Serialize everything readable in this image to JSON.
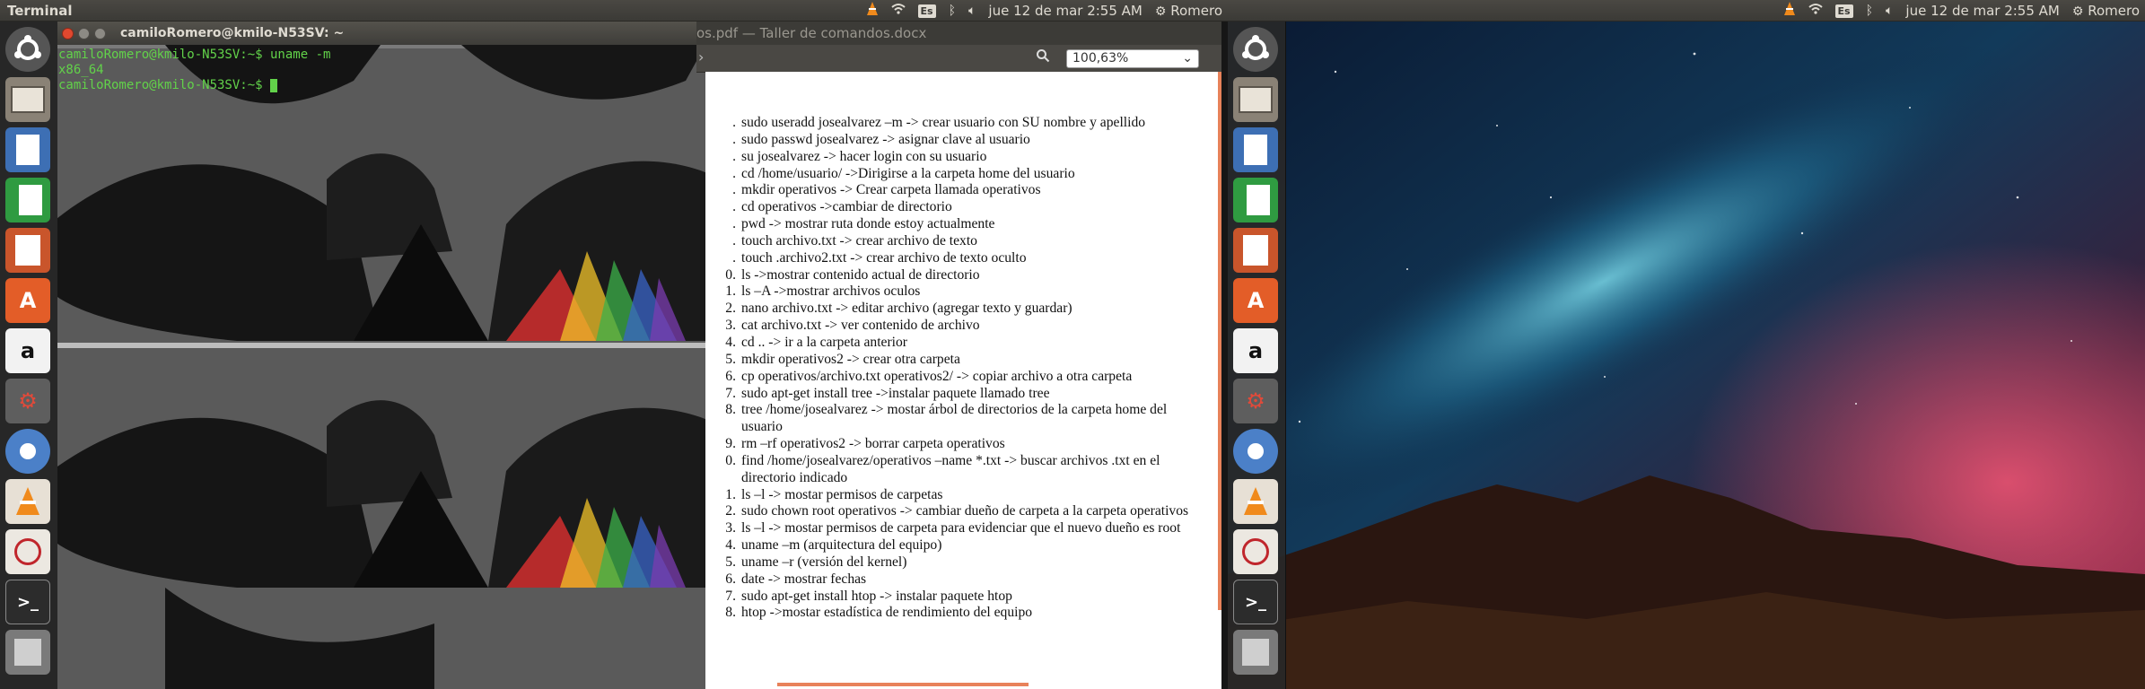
{
  "left_panel": {
    "app_title": "Terminal",
    "keyboard_layout": "Es",
    "datetime": "jue 12 de mar  2:55 AM",
    "user": "Romero"
  },
  "right_panel": {
    "keyboard_layout": "Es",
    "datetime": "jue 12 de mar  2:55 AM",
    "user": "Romero"
  },
  "terminal": {
    "window_title": "camiloRomero@kmilo-N53SV: ~",
    "lines": [
      "camiloRomero@kmilo-N53SV:~$ uname -m",
      "x86_64",
      "camiloRomero@kmilo-N53SV:~$ "
    ]
  },
  "viewer": {
    "title": "os.pdf — Taller de comandos.docx",
    "zoom": "100,63%",
    "items": [
      {
        "n": ".",
        "t": "sudo  useradd josealvarez –m -> crear usuario con SU nombre y apellido"
      },
      {
        "n": ".",
        "t": "sudo passwd josealvarez -> asignar clave al usuario"
      },
      {
        "n": ".",
        "t": "su josealvarez -> hacer login con su usuario"
      },
      {
        "n": ".",
        "t": "cd /home/usuario/ ->Dirigirse a la carpeta home del usuario"
      },
      {
        "n": ".",
        "t": "mkdir operativos -> Crear carpeta llamada operativos"
      },
      {
        "n": ".",
        "t": "cd operativos ->cambiar de directorio"
      },
      {
        "n": ".",
        "t": "pwd -> mostrar ruta donde estoy actualmente"
      },
      {
        "n": ".",
        "t": "touch archivo.txt -> crear archivo de texto"
      },
      {
        "n": ".",
        "t": "touch .archivo2.txt -> crear archivo de texto oculto"
      },
      {
        "n": "0.",
        "t": "ls ->mostrar contenido actual de directorio"
      },
      {
        "n": "1.",
        "t": "ls –A ->mostrar archivos oculos"
      },
      {
        "n": "2.",
        "t": "nano archivo.txt -> editar archivo (agregar texto y guardar)"
      },
      {
        "n": "3.",
        "t": "cat archivo.txt -> ver contenido de archivo"
      },
      {
        "n": "4.",
        "t": "cd .. -> ir a la carpeta anterior"
      },
      {
        "n": "5.",
        "t": "mkdir operativos2 -> crear otra carpeta"
      },
      {
        "n": "6.",
        "t": "cp operativos/archivo.txt operativos2/ -> copiar archivo a otra carpeta"
      },
      {
        "n": "7.",
        "t": "sudo apt-get install tree ->instalar paquete llamado tree"
      },
      {
        "n": "8.",
        "t": "tree /home/josealvarez -> mostar árbol de directorios de la carpeta home del usuario"
      },
      {
        "n": "9.",
        "t": "rm –rf operativos2 -> borrar carpeta operativos"
      },
      {
        "n": "0.",
        "t": "find /home/josealvarez/operativos –name *.txt -> buscar archivos .txt en el directorio indicado"
      },
      {
        "n": "1.",
        "t": "ls –l -> mostar permisos de carpetas"
      },
      {
        "n": "2.",
        "t": "sudo chown root operativos -> cambiar dueño de carpeta a la carpeta operativos"
      },
      {
        "n": "3.",
        "t": "ls –l -> mostar permisos de carpeta para evidenciar que el nuevo dueño es root"
      },
      {
        "n": "4.",
        "t": "uname –m (arquitectura del equipo)"
      },
      {
        "n": "5.",
        "t": "uname –r (versión del kernel)"
      },
      {
        "n": "6.",
        "t": "date -> mostrar fechas"
      },
      {
        "n": "7.",
        "t": "sudo apt-get install htop -> instalar paquete htop"
      },
      {
        "n": "8.",
        "t": "htop ->mostar estadística de rendimiento del equipo"
      }
    ]
  },
  "launcher_icons": [
    "ubuntu-dash",
    "files",
    "libreoffice-writer",
    "libreoffice-calc",
    "libreoffice-impress",
    "software-center",
    "amazon",
    "system-settings",
    "chromium",
    "vlc",
    "evince",
    "terminal",
    "trash"
  ]
}
